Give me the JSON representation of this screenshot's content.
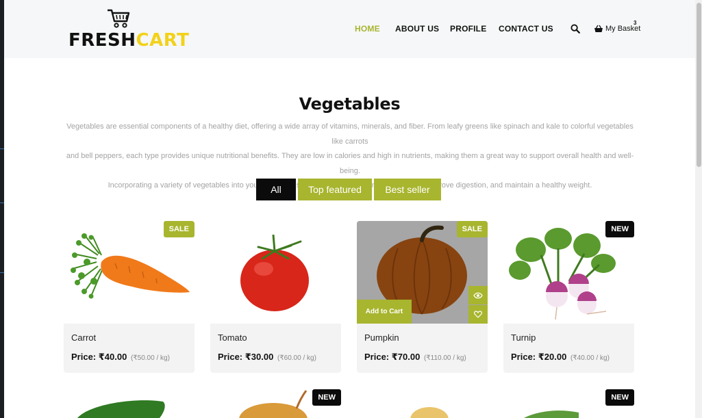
{
  "brand": {
    "word_a": "FRESH",
    "word_b": "CART",
    "accent": "#a8b52e",
    "yellow": "#f2d21a"
  },
  "nav": {
    "home": "HOME",
    "about": "ABOUT US",
    "profile": "PROFILE",
    "contact": "CONTACT US",
    "basket_label": "My Basket",
    "basket_count": "3",
    "icons": [
      "search-icon",
      "basket-icon"
    ]
  },
  "section": {
    "title": "Vegetables",
    "description_lines": [
      "Vegetables are essential components of a healthy diet, offering a wide array of vitamins, minerals, and fiber. From leafy greens like spinach and kale to colorful vegetables like carrots",
      "and bell peppers, each type provides unique nutritional benefits. They are low in calories and high in nutrients, making them a great way to support overall health and well-being.",
      "Incorporating a variety of vegetables into your daily meals can help boost your immune system, improve digestion, and maintain a healthy weight."
    ]
  },
  "filters": {
    "all": "All",
    "top": "Top featured",
    "best": "Best seller"
  },
  "products": [
    {
      "name": "Carrot",
      "price": "Price: ₹40.00",
      "old": "(₹50.00 / kg)",
      "tag": "SALE"
    },
    {
      "name": "Tomato",
      "price": "Price: ₹30.00",
      "old": "(₹60.00 / kg)",
      "tag": ""
    },
    {
      "name": "Pumpkin",
      "price": "Price: ₹70.00",
      "old": "(₹110.00 / kg)",
      "tag": "SALE",
      "add_to_cart": "Add to Cart"
    },
    {
      "name": "Turnip",
      "price": "Price: ₹20.00",
      "old": "(₹40.00 / kg)",
      "tag": "NEW"
    }
  ],
  "row2_tags": [
    "",
    "NEW",
    "",
    "NEW"
  ]
}
